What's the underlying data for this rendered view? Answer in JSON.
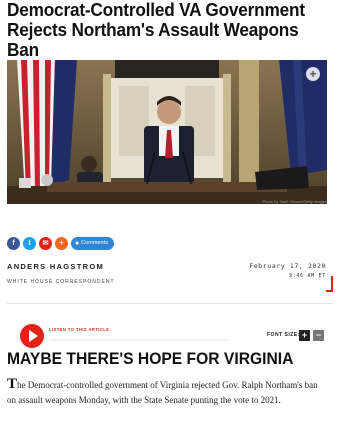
{
  "article": {
    "headline": "Democrat-Controlled VA Government Rejects Northam's Assault Weapons Ban",
    "photo_credit": "Photo by Zach Gibson/Getty Images",
    "author": "ANDERS HAGSTROM",
    "author_title": "WHITE HOUSE CORRESPONDENT",
    "date": "February 17, 2020",
    "time": "9:46 AM ET",
    "subheadline": "MAYBE THERE'S HOPE FOR VIRGINIA",
    "body_drop_cap": "T",
    "body_text": "he Democrat-controlled government of Virginia rejected Gov. Ralph Northam's ban on assault weapons Monday, with the State Senate punting the vote to 2021."
  },
  "share": {
    "comments_label": "Comments",
    "buttons": [
      {
        "icon": "facebook-icon",
        "glyph": "f",
        "color": "#3b5998"
      },
      {
        "icon": "twitter-icon",
        "glyph": "t",
        "color": "#1da1f2"
      },
      {
        "icon": "email-icon",
        "glyph": "✉",
        "color": "#e2231a"
      },
      {
        "icon": "more-share-icon",
        "glyph": "+",
        "color": "#f26522"
      }
    ]
  },
  "audio": {
    "listen_label": "LISTEN TO THIS ARTICLE"
  },
  "font_controls": {
    "label": "FONT SIZE:",
    "increase_glyph": "+",
    "decrease_glyph": "−"
  },
  "colors": {
    "accent_red": "#e2231a",
    "comments_blue": "#2f86d6"
  }
}
